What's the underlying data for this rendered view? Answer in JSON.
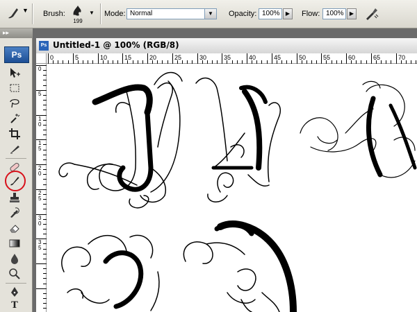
{
  "options_bar": {
    "tool_icon": "brush-tool-icon",
    "brush_label": "Brush:",
    "brush_size": "199",
    "mode_label": "Mode:",
    "mode_value": "Normal",
    "opacity_label": "Opacity:",
    "opacity_value": "100%",
    "flow_label": "Flow:",
    "flow_value": "100%",
    "airbrush_icon": "airbrush-icon"
  },
  "tools_panel": {
    "logo": "Ps",
    "selected_tool": "brush-tool",
    "highlight_color": "#d8111b",
    "tools": [
      "move-tool-icon",
      "marquee-tool-icon",
      "lasso-tool-icon",
      "magic-wand-tool-icon",
      "crop-tool-icon",
      "slice-tool-icon",
      "healing-brush-tool-icon",
      "brush-tool-icon",
      "clone-stamp-tool-icon",
      "history-brush-tool-icon",
      "eraser-tool-icon",
      "gradient-tool-icon",
      "blur-tool-icon",
      "dodge-tool-icon",
      "pen-tool-icon",
      "type-tool-icon"
    ],
    "type_tool_glyph": "T"
  },
  "document": {
    "title": "Untitled-1 @ 100% (RGB/8)",
    "icon_text": "Ps",
    "ruler_top_labels": [
      "0",
      "5",
      "10",
      "15",
      "20",
      "25",
      "30",
      "35",
      "40",
      "45",
      "50",
      "55",
      "60",
      "65",
      "70"
    ],
    "ruler_left_labels": [
      "0",
      "5",
      "10",
      "15",
      "20",
      "25",
      "30",
      "35"
    ]
  },
  "colors": {
    "accent_highlight": "#d8111b",
    "ps_logo": "#2a64b8",
    "workspace": "#6b6b6b"
  }
}
